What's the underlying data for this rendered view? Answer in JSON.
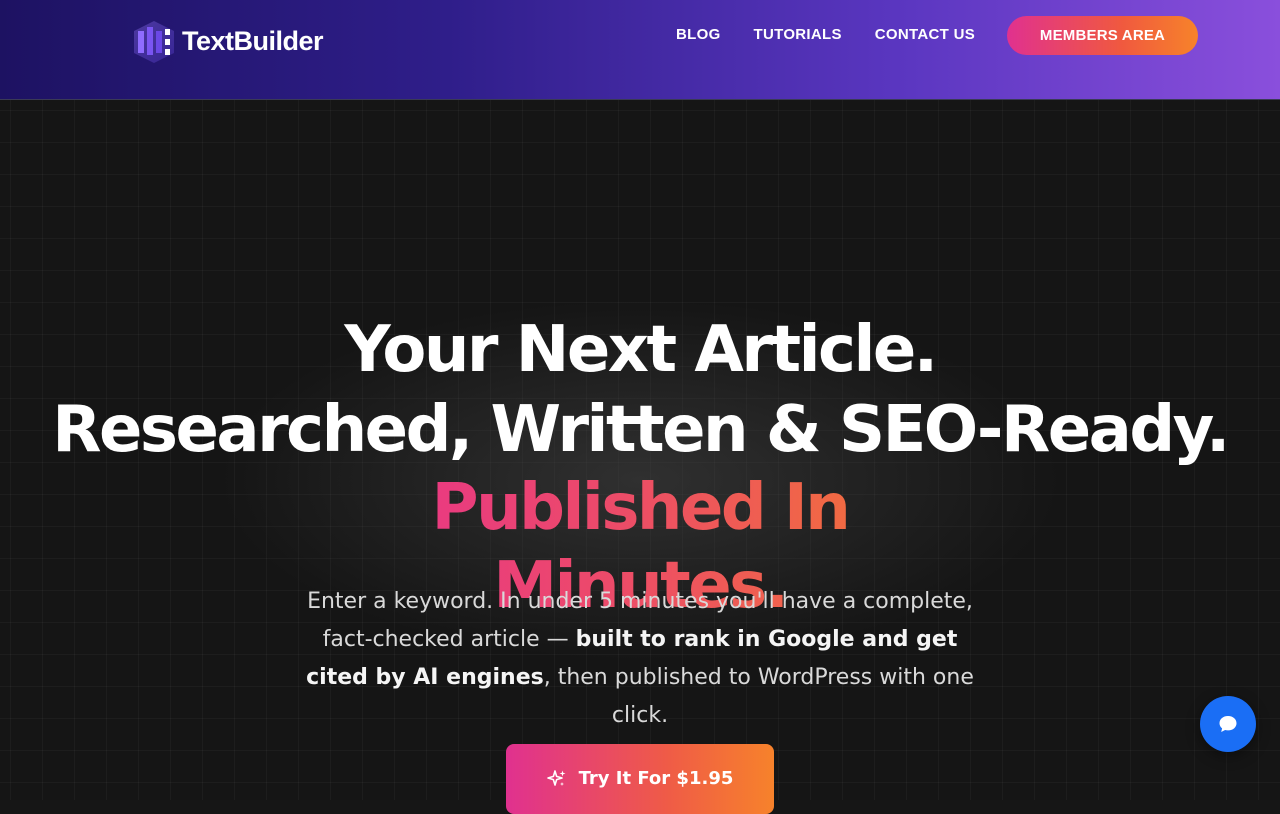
{
  "brand": {
    "name": "TextBuilder"
  },
  "nav": {
    "items": [
      {
        "label": "BLOG"
      },
      {
        "label": "TUTORIALS"
      },
      {
        "label": "CONTACT US"
      }
    ],
    "members_label": "MEMBERS AREA"
  },
  "hero": {
    "line1": "Your Next Article.",
    "line2": "Researched, Written & SEO-Ready.",
    "line3": "Published In Minutes.",
    "sub_part1": "Enter a keyword. In under 5 minutes you'll have a complete, fact-checked article — ",
    "sub_bold": "built to rank in Google and get cited by AI engines",
    "sub_part2": ", then published to WordPress with one click.",
    "cta_label": "Try It For $1.95"
  },
  "colors": {
    "header_start": "#1d1262",
    "header_end": "#8a4fdc",
    "accent_pink": "#e0318f",
    "accent_orange": "#f7832a",
    "chat_blue": "#1a6ef5",
    "background": "#151515"
  },
  "icons": {
    "logo": "textbuilder-logo-icon",
    "cta": "sparkle-icon",
    "chat": "chat-bubble-icon"
  }
}
